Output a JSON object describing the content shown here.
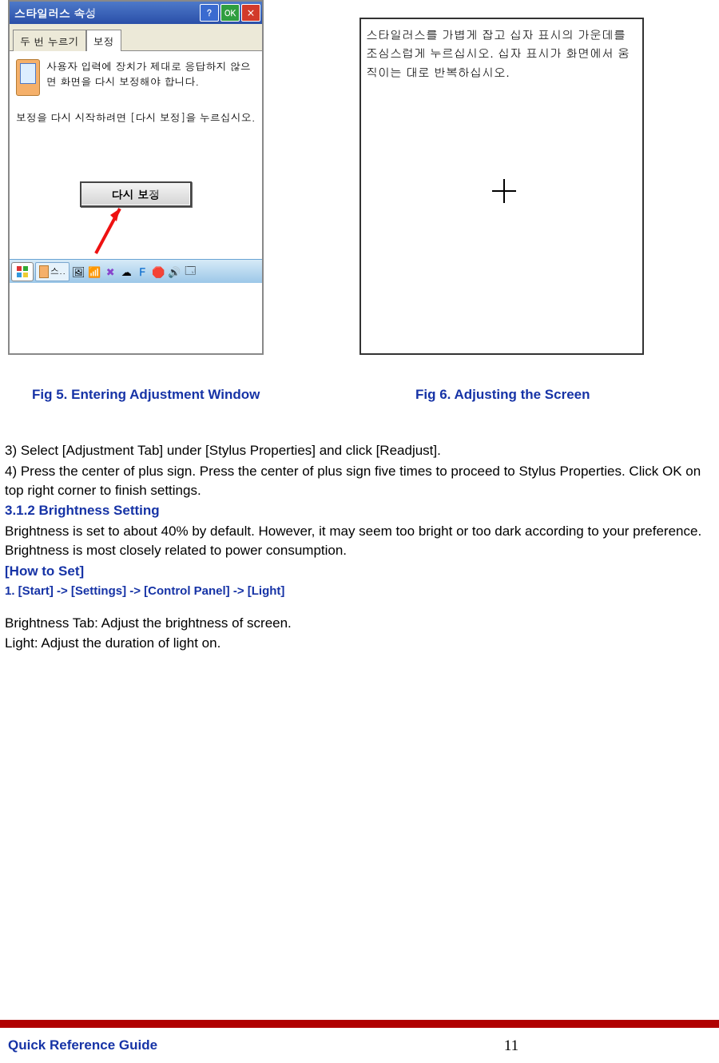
{
  "fig5": {
    "window_title": "스타일러스 속성",
    "btn_help": "?",
    "btn_ok": "OK",
    "btn_close": "×",
    "tab_inactive": "두 번 누르기",
    "tab_active": "보정",
    "para1": "사용자 입력에 장치가 제대로 응답하지 않으면 화면을 다시 보정해야 합니다.",
    "para2": "보정을 다시 시작하려면 [다시 보정]을 누르십시오.",
    "readjust_button": "다시 보정",
    "task_label": "스..",
    "tray_f": "F"
  },
  "fig6": {
    "instruction": "스타일러스를 가볍게 잡고 십자 표시의 가운데를 조심스럽게 누르십시오. 십자 표시가 화면에서 움직이는 대로 반복하십시오."
  },
  "captions": {
    "fig5": "Fig 5. Entering Adjustment Window",
    "fig6": "Fig 6. Adjusting the Screen"
  },
  "steps": {
    "s3": " 3) Select [Adjustment Tab] under [Stylus Properties] and click [Readjust].",
    "s4": " 4) Press the center of plus sign.   Press the center of plus sign five times to proceed to Stylus Properties.   Click OK on top right corner to finish settings."
  },
  "section": {
    "heading": "3.1.2 Brightness Setting",
    "desc": "Brightness is set to about 40% by default.   However, it may seem too bright or too dark according to your preference.   Brightness is most closely related to power consumption.",
    "howto": " [How to Set]",
    "path": "1. [Start] -> [Settings] -> [Control Panel] -> [Light]",
    "line1": "  Brightness Tab: Adjust the brightness of screen.",
    "line2": "  Light: Adjust the duration of light on."
  },
  "footer": {
    "title": "Quick Reference Guide",
    "page": "11"
  }
}
